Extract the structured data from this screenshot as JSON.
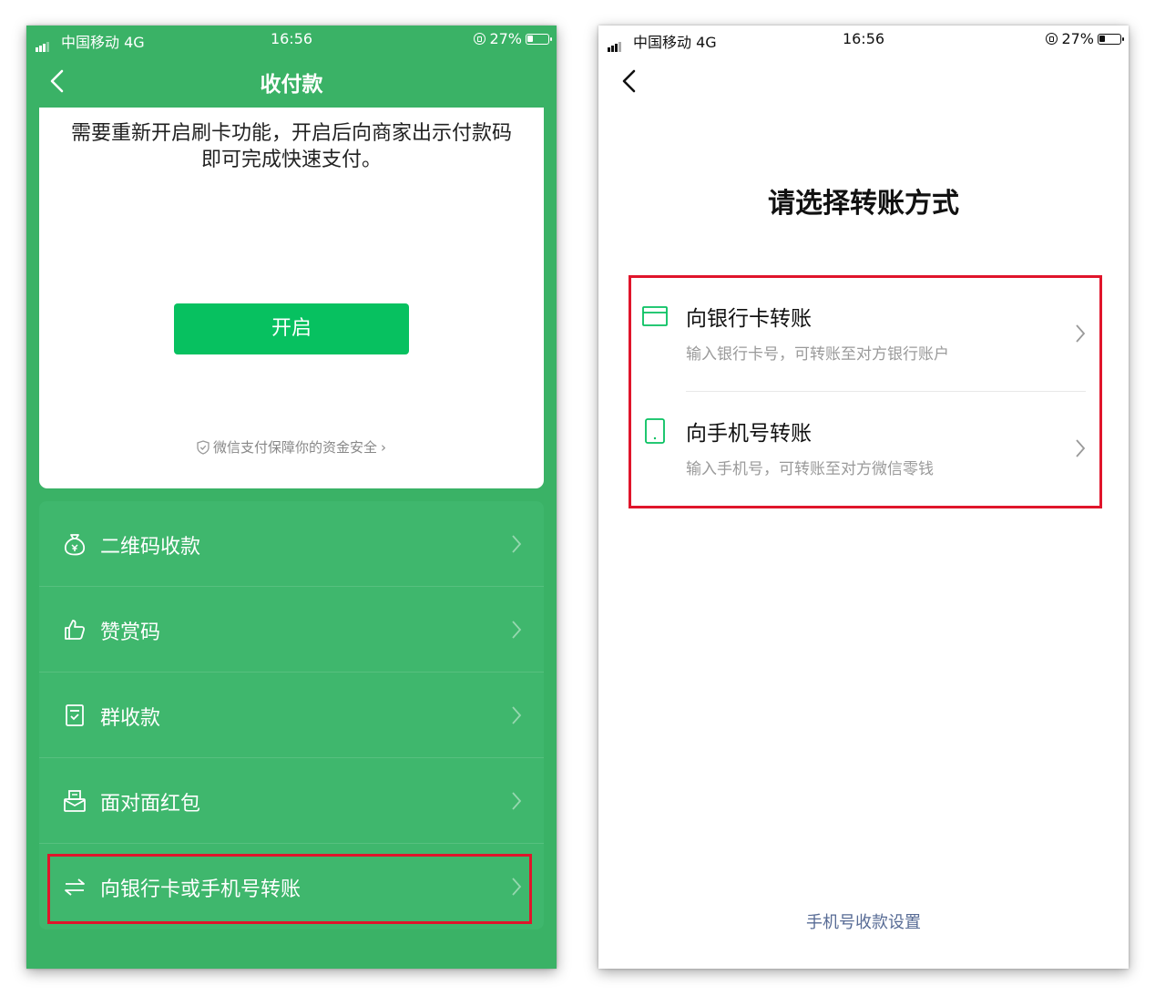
{
  "status_bar": {
    "carrier": "中国移动 4G",
    "time": "16:56",
    "battery": "27%"
  },
  "left_screen": {
    "nav_title": "收付款",
    "card_message": "需要重新开启刷卡功能，开启后向商家出示付款码即可完成快速支付。",
    "open_button": "开启",
    "security_note": "微信支付保障你的资金安全",
    "menu": [
      {
        "label": "二维码收款",
        "icon": "money-bag-icon"
      },
      {
        "label": "赞赏码",
        "icon": "thumb-up-icon"
      },
      {
        "label": "群收款",
        "icon": "group-collect-icon"
      },
      {
        "label": "面对面红包",
        "icon": "red-packet-icon"
      },
      {
        "label": "向银行卡或手机号转账",
        "icon": "transfer-arrows-icon"
      }
    ],
    "highlighted_item": "向银行卡或手机号转账"
  },
  "right_screen": {
    "title": "请选择转账方式",
    "options": [
      {
        "title": "向银行卡转账",
        "desc": "输入银行卡号，可转账至对方银行账户",
        "icon": "bank-card-icon"
      },
      {
        "title": "向手机号转账",
        "desc": "输入手机号，可转账至对方微信零钱",
        "icon": "mobile-phone-icon"
      }
    ],
    "bottom_link": "手机号收款设置"
  },
  "colors": {
    "wechat_green": "#07c160",
    "menu_green": "#3fb76d",
    "highlight_red": "#e0152b",
    "link_blue": "#576b95"
  }
}
